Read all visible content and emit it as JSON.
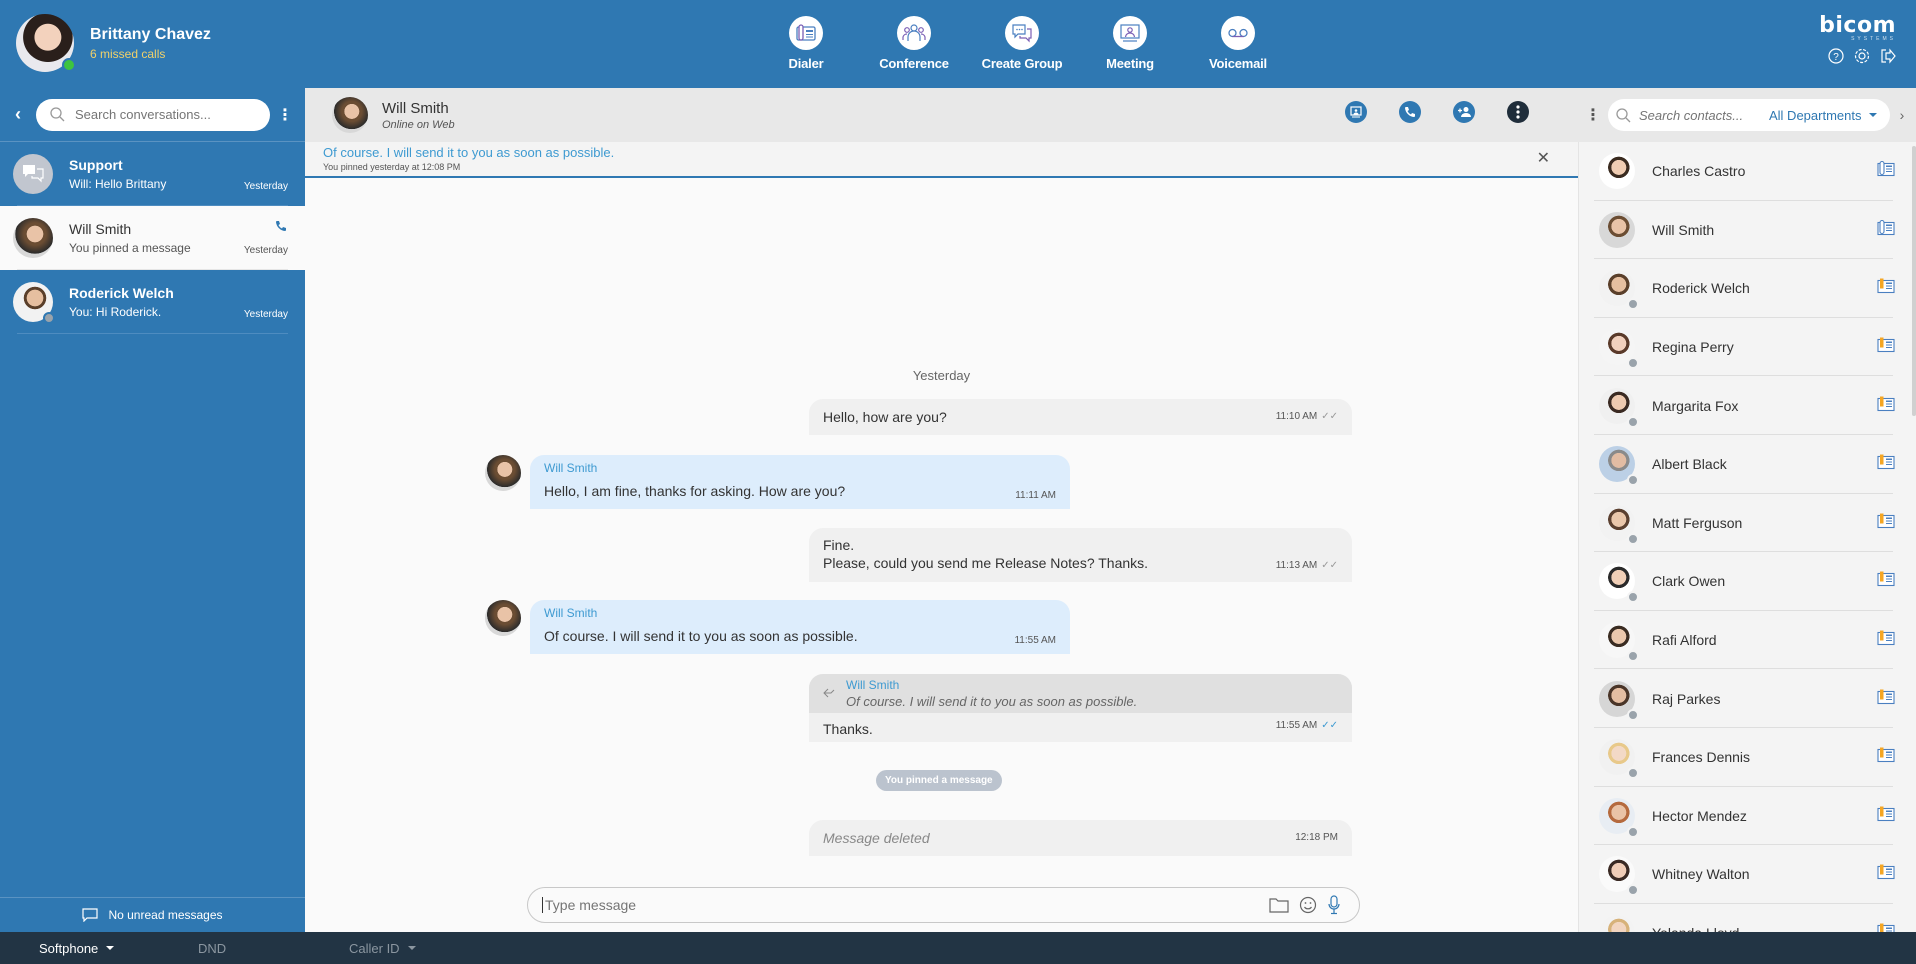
{
  "user": {
    "name": "Brittany Chavez",
    "missed_calls": "6 missed calls",
    "status_color": "#3ec43e"
  },
  "nav": [
    {
      "label": "Dialer",
      "icon": "desk-phone-icon"
    },
    {
      "label": "Conference",
      "icon": "group-icon"
    },
    {
      "label": "Create Group",
      "icon": "chat-bubbles-icon"
    },
    {
      "label": "Meeting",
      "icon": "meeting-screen-icon"
    },
    {
      "label": "Voicemail",
      "icon": "voicemail-icon"
    }
  ],
  "brand": {
    "logo": "bicom",
    "sub": "SYSTEMS",
    "icons": [
      "help-icon",
      "settings-icon",
      "logout-icon"
    ]
  },
  "sidebar": {
    "search_placeholder": "Search conversations...",
    "conversations": [
      {
        "name": "Support",
        "last": "Will: Hello Brittany",
        "time": "Yesterday",
        "active": false
      },
      {
        "name": "Will Smith",
        "last": "You pinned a message",
        "time": "Yesterday",
        "active": true,
        "call_icon": true
      },
      {
        "name": "Roderick Welch",
        "last": "You: Hi Roderick.",
        "time": "Yesterday",
        "active": false
      }
    ],
    "footer": "No unread messages"
  },
  "chat": {
    "name": "Will Smith",
    "status": "Online on Web",
    "actions": [
      "screen-share-icon",
      "phone-icon",
      "add-participant-icon",
      "more-icon"
    ],
    "pinned": {
      "text": "Of course. I will send it to you as soon as possible.",
      "sub": "You pinned yesterday at 12:08 PM"
    },
    "day_separator": "Yesterday",
    "messages": [
      {
        "dir": "out",
        "text": "Hello, how are you?",
        "time": "11:10 AM",
        "ticks": "✓✓"
      },
      {
        "dir": "in",
        "sender": "Will Smith",
        "text": "Hello, I am fine, thanks for asking. How are you?",
        "time": "11:11 AM"
      },
      {
        "dir": "out",
        "line1": "Fine.",
        "line2": "Please, could you send me Release Notes? Thanks.",
        "time": "11:13 AM",
        "ticks": "✓✓"
      },
      {
        "dir": "in",
        "sender": "Will Smith",
        "text": "Of course. I will send it to you as soon as possible.",
        "time": "11:55 AM"
      },
      {
        "dir": "out",
        "reply_sender": "Will Smith",
        "reply_text": "Of course. I will send it to you as soon as possible.",
        "text": "Thanks.",
        "time": "11:55 AM",
        "ticks": "✓✓"
      },
      {
        "dir": "out",
        "deleted": true,
        "text": "Message deleted",
        "time": "12:18 PM"
      }
    ],
    "system_pill": "You pinned a message",
    "composer_placeholder": "Type message"
  },
  "contacts": {
    "search_placeholder": "Search contacts...",
    "department": "All Departments",
    "list": [
      {
        "name": "Charles Castro",
        "online": true,
        "phone_status": "available"
      },
      {
        "name": "Will Smith",
        "online": true,
        "phone_status": "available"
      },
      {
        "name": "Roderick Welch",
        "online": false,
        "phone_status": "offline"
      },
      {
        "name": "Regina Perry",
        "online": false,
        "phone_status": "offline"
      },
      {
        "name": "Margarita Fox",
        "online": false,
        "phone_status": "offline"
      },
      {
        "name": "Albert Black",
        "online": false,
        "phone_status": "offline"
      },
      {
        "name": "Matt Ferguson",
        "online": false,
        "phone_status": "offline"
      },
      {
        "name": "Clark Owen",
        "online": false,
        "phone_status": "offline"
      },
      {
        "name": "Rafi Alford",
        "online": false,
        "phone_status": "offline"
      },
      {
        "name": "Raj Parkes",
        "online": false,
        "phone_status": "offline"
      },
      {
        "name": "Frances Dennis",
        "online": false,
        "phone_status": "offline"
      },
      {
        "name": "Hector Mendez",
        "online": false,
        "phone_status": "offline"
      },
      {
        "name": "Whitney Walton",
        "online": false,
        "phone_status": "offline"
      },
      {
        "name": "Yolanda Lloyd",
        "online": false,
        "phone_status": "offline"
      }
    ]
  },
  "statusbar": {
    "softphone": "Softphone",
    "dnd": "DND",
    "caller_id": "Caller ID"
  },
  "colors": {
    "primary": "#2f78b2",
    "dark": "#223444",
    "accent_text": "#3e9ad1",
    "missed": "#f0d16a",
    "phone_offline": "#f5a623"
  }
}
